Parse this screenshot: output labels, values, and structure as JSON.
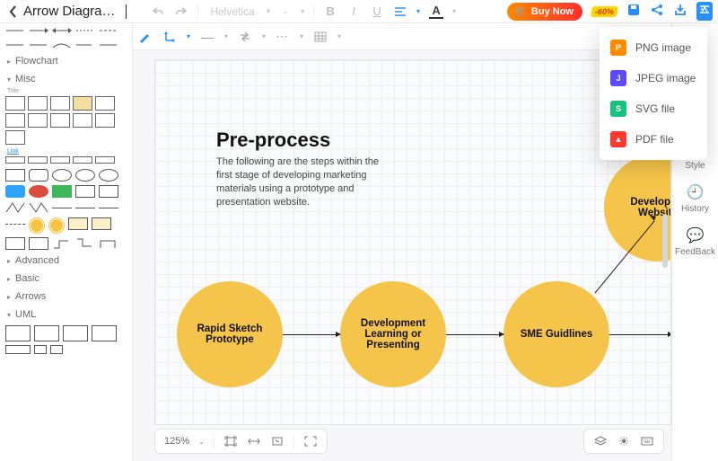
{
  "header": {
    "doc_title": "Arrow Diagramm",
    "font_name": "Helvetica",
    "font_size": "-",
    "bold": "B",
    "italic": "I",
    "underline": "U",
    "text_color": "A",
    "buy_label": "Buy Now",
    "sale_badge": "-60%"
  },
  "toolbar2": {
    "items": [
      "pencil",
      "snap",
      "line-style",
      "swap",
      "more",
      "table"
    ]
  },
  "left_panel": {
    "sections": {
      "flowchart": {
        "label": "Flowchart",
        "expanded": false
      },
      "misc": {
        "label": "Misc",
        "expanded": true,
        "sub_title": "Title",
        "sub_link": "Link"
      },
      "advanced": {
        "label": "Advanced",
        "expanded": false
      },
      "basic": {
        "label": "Basic",
        "expanded": false
      },
      "arrows": {
        "label": "Arrows",
        "expanded": false
      },
      "uml": {
        "label": "UML",
        "expanded": true
      }
    }
  },
  "right_panel": {
    "style": "Style",
    "history": "History",
    "feedback": "FeedBack"
  },
  "canvas": {
    "title": "Pre-process",
    "description": "The following are the steps within the first stage of developing marketing materials using a prototype and presentation website.",
    "nodes": {
      "n1": "Rapid Sketch Prototype",
      "n2": "Development Learning or Presenting",
      "n3": "SME Guidlines",
      "n4": "Developme Website"
    }
  },
  "zoombar": {
    "level": "125%"
  },
  "export_menu": {
    "png": "PNG image",
    "jpeg": "JPEG image",
    "svg": "SVG file",
    "pdf": "PDF file"
  },
  "colors": {
    "accent": "#2b90ff",
    "node": "#f4c54a"
  }
}
